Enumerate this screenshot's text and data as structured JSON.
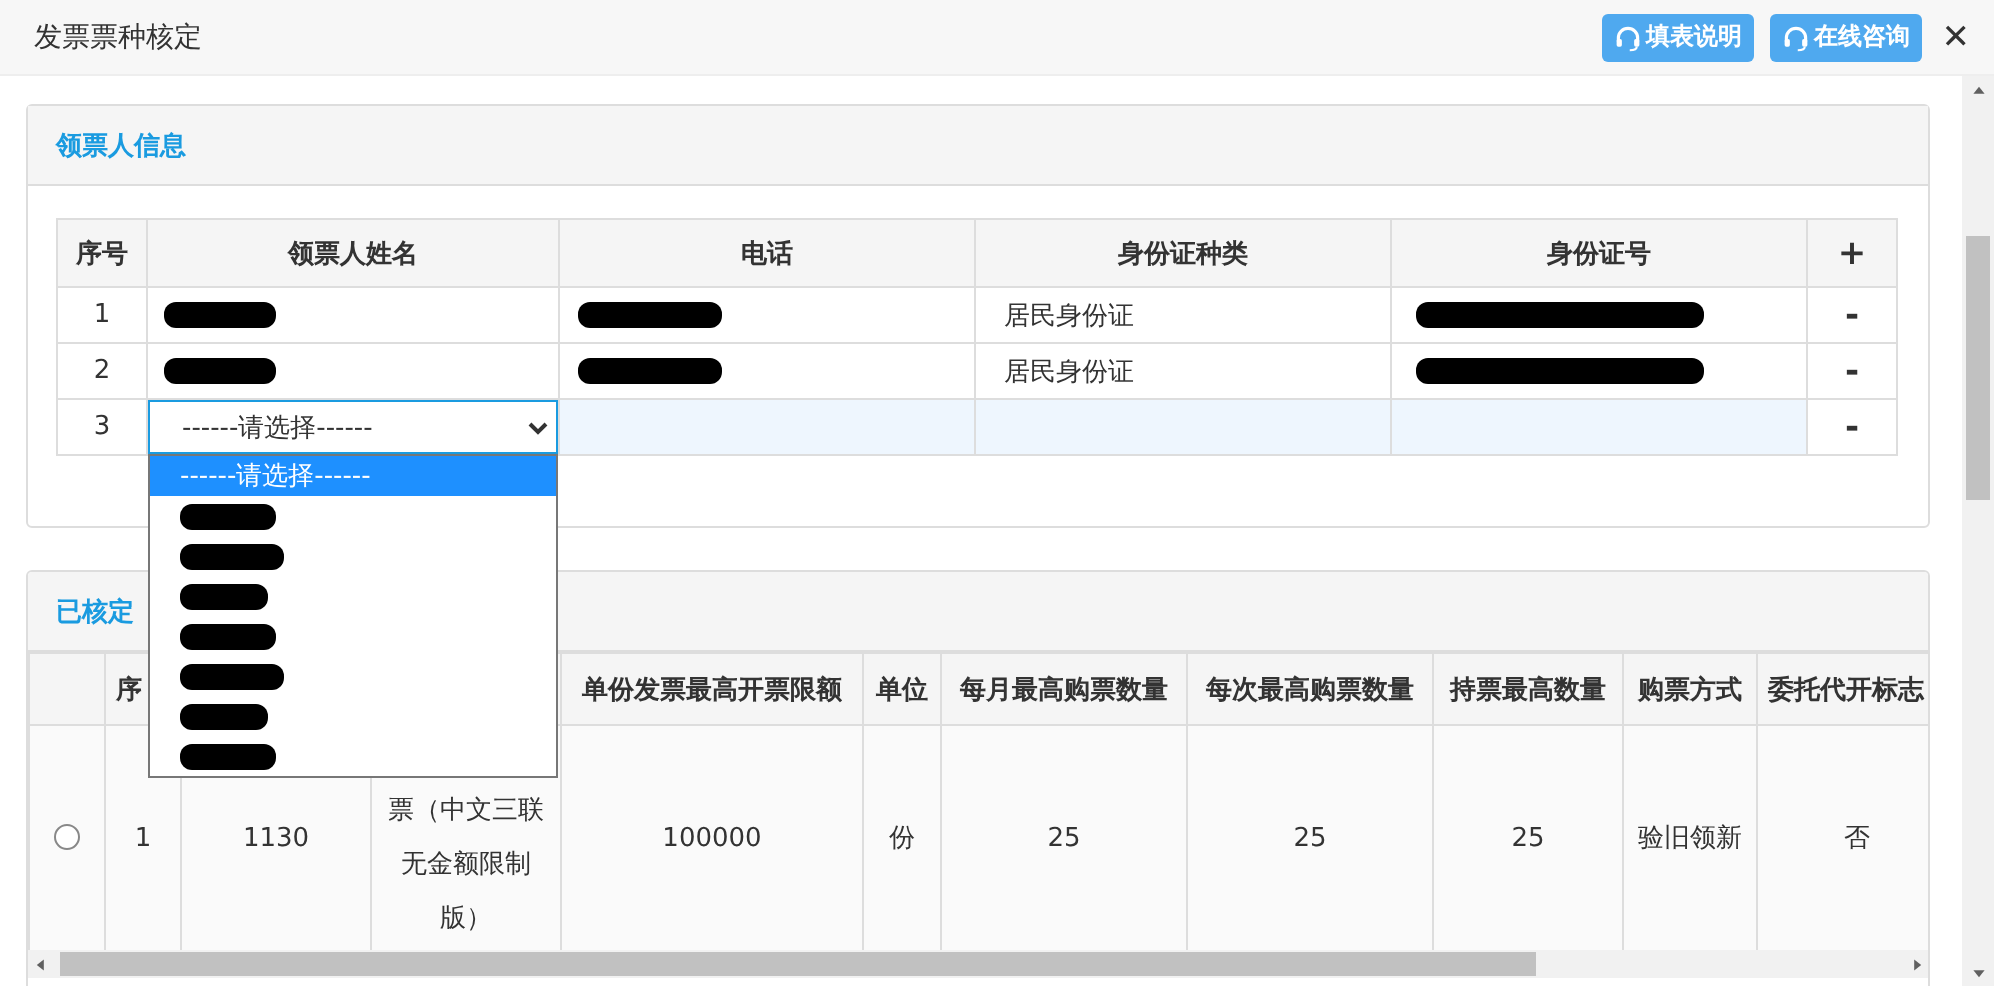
{
  "window": {
    "title": "发票票种核定",
    "buttons": [
      "填表说明",
      "在线咨询"
    ],
    "close": "✕"
  },
  "recipients": {
    "title": "领票人信息",
    "columns": [
      "序号",
      "领票人姓名",
      "电话",
      "身份证种类",
      "身份证号"
    ],
    "add": "+",
    "rows": [
      {
        "kind": "filled",
        "index": "1",
        "name": {
          "redacted": true
        },
        "phone": {
          "redacted": true
        },
        "id_type": "居民身份证",
        "id_number": {
          "redacted": true
        },
        "remove": "-"
      },
      {
        "kind": "filled",
        "index": "2",
        "name": {
          "redacted": true
        },
        "phone": {
          "redacted": true
        },
        "id_type": "居民身份证",
        "id_number": {
          "redacted": true
        },
        "remove": "-"
      },
      {
        "kind": "new",
        "index": "3",
        "select": {
          "value": "------请选择------",
          "expanded": true,
          "options": [
            {
              "label": "------请选择------",
              "selected": true
            },
            {
              "redacted": true,
              "selected": false
            },
            {
              "redacted": true,
              "selected": false
            },
            {
              "redacted": true,
              "selected": false
            },
            {
              "redacted": true,
              "selected": false
            },
            {
              "redacted": true,
              "selected": false
            },
            {
              "redacted": true,
              "selected": false
            },
            {
              "redacted": true,
              "selected": false
            }
          ]
        },
        "remove": "-"
      }
    ]
  },
  "approved": {
    "title": "已核定",
    "columns": [
      {
        "kind": "text",
        "label": "序"
      },
      {
        "kind": "covered"
      },
      {
        "kind": "covered"
      },
      {
        "kind": "text",
        "label": "单份发票最高开票限额"
      },
      {
        "kind": "text",
        "label": "单位"
      },
      {
        "kind": "text",
        "label": "每月最高购票数量"
      },
      {
        "kind": "text",
        "label": "每次最高购票数量"
      },
      {
        "kind": "text",
        "label": "持票最高数量"
      },
      {
        "kind": "text",
        "label": "购票方式"
      },
      {
        "kind": "text",
        "label": "委托代开标志"
      }
    ],
    "rows": [
      {
        "selected": false,
        "cells": [
          "1",
          "1130",
          "票（中文三联无金额限制版）",
          "100000",
          "份",
          "25",
          "25",
          "25",
          "验旧领新",
          "否"
        ]
      }
    ]
  }
}
